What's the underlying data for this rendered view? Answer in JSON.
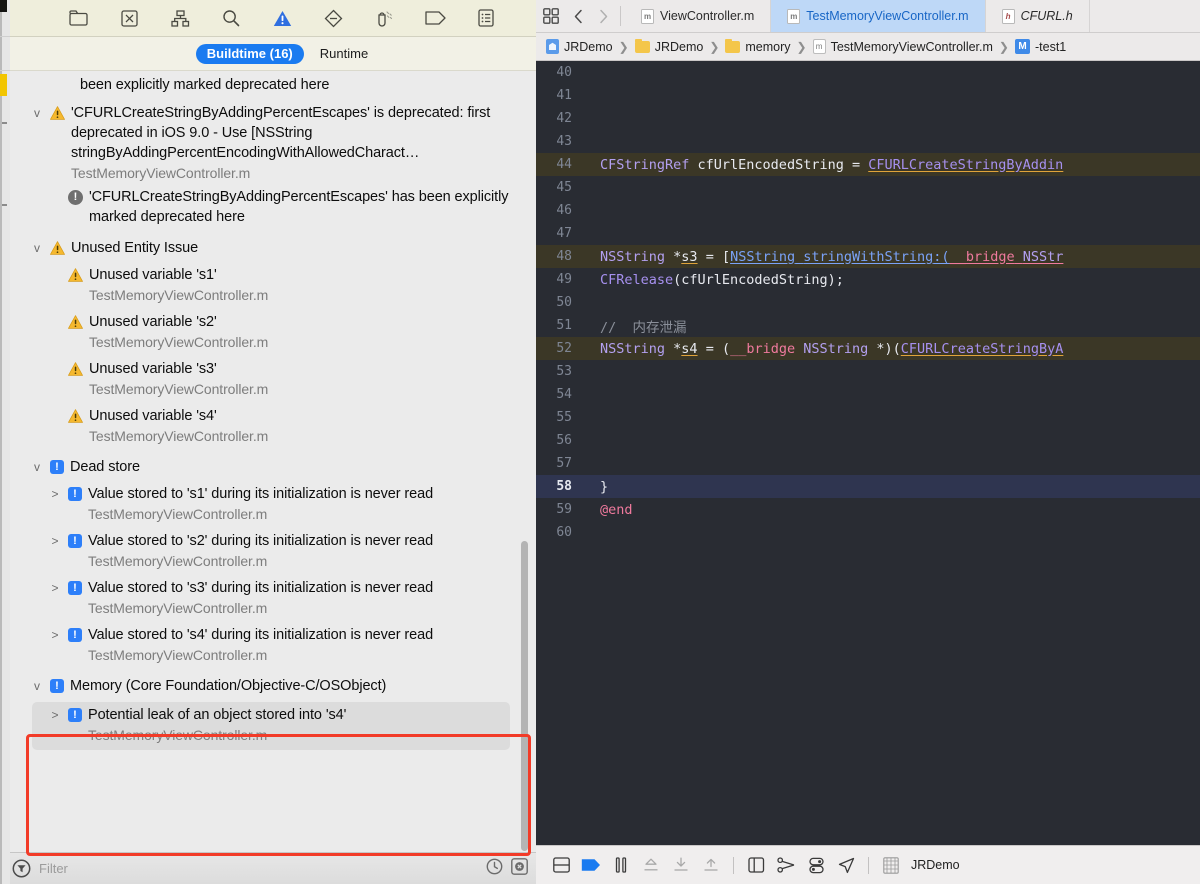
{
  "navigator": {
    "toolbar_icons": [
      "folder-icon",
      "source-control-icon",
      "symbol-hierarchy-icon",
      "search-icon",
      "issue-warning-icon",
      "test-diamond-icon",
      "debug-icon",
      "breakpoint-tag-icon",
      "report-icon"
    ],
    "scope": {
      "buildtime_label": "Buildtime (16)",
      "runtime_label": "Runtime"
    },
    "partial_top_text": "been explicitly marked deprecated here",
    "groups": [
      {
        "id": "deprecation",
        "disclosure": "v",
        "badge": "warning",
        "title": "'CFURLCreateStringByAddingPercentEscapes' is deprecated: first deprecated in iOS 9.0 - Use [NSString stringByAddingPercentEncodingWithAllowedCharact…",
        "file": "TestMemoryViewController.m",
        "children": [
          {
            "badge": "note",
            "title": "'CFURLCreateStringByAddingPercentEscapes' has been explicitly marked deprecated here",
            "file": ""
          }
        ]
      },
      {
        "id": "unused-entity-issue",
        "disclosure": "v",
        "badge": "warning",
        "title": "Unused Entity Issue",
        "file": "",
        "children": [
          {
            "badge": "warning",
            "title": "Unused variable 's1'",
            "file": "TestMemoryViewController.m"
          },
          {
            "badge": "warning",
            "title": "Unused variable 's2'",
            "file": "TestMemoryViewController.m"
          },
          {
            "badge": "warning",
            "title": "Unused variable 's3'",
            "file": "TestMemoryViewController.m"
          },
          {
            "badge": "warning",
            "title": "Unused variable 's4'",
            "file": "TestMemoryViewController.m"
          }
        ]
      },
      {
        "id": "dead-store",
        "disclosure": "v",
        "badge": "issue",
        "title": "Dead store",
        "file": "",
        "children": [
          {
            "badge": "issue",
            "disclosure": ">",
            "title": "Value stored to 's1' during its initialization is never read",
            "file": "TestMemoryViewController.m"
          },
          {
            "badge": "issue",
            "disclosure": ">",
            "title": "Value stored to 's2' during its initialization is never read",
            "file": "TestMemoryViewController.m"
          },
          {
            "badge": "issue",
            "disclosure": ">",
            "title": "Value stored to 's3' during its initialization is never read",
            "file": "TestMemoryViewController.m"
          },
          {
            "badge": "issue",
            "disclosure": ">",
            "title": "Value stored to 's4' during its initialization is never read",
            "file": "TestMemoryViewController.m"
          }
        ]
      },
      {
        "id": "memory",
        "disclosure": "v",
        "badge": "issue",
        "highlighted": true,
        "title": "Memory (Core Foundation/Objective-C/OSObject)",
        "file": "",
        "children": [
          {
            "badge": "issue",
            "disclosure": ">",
            "selected": true,
            "title": "Potential leak of an object stored into 's4'",
            "file": "TestMemoryViewController.m"
          }
        ]
      }
    ],
    "filter": {
      "placeholder": "Filter",
      "icons": [
        "filter-funnel-icon",
        "recent-clock-icon",
        "clear-x-icon"
      ]
    }
  },
  "editor": {
    "tabs": [
      {
        "kind": "m",
        "label": "ViewController.m",
        "active": false,
        "italic": false
      },
      {
        "kind": "m",
        "label": "TestMemoryViewController.m",
        "active": true,
        "italic": false
      },
      {
        "kind": "h",
        "label": "CFURL.h",
        "active": false,
        "italic": true
      }
    ],
    "nav_back_label": "‹",
    "nav_fwd_label": "›",
    "breadcrumb": [
      {
        "icon": "project-icon",
        "label": "JRDemo"
      },
      {
        "icon": "folder-icon",
        "label": "JRDemo"
      },
      {
        "icon": "folder-icon",
        "label": "memory"
      },
      {
        "icon": "m-file-icon",
        "label": "TestMemoryViewController.m"
      },
      {
        "icon": "method-icon",
        "label": "-test1"
      }
    ],
    "code_lines": [
      {
        "n": "40",
        "state": "",
        "tokens": []
      },
      {
        "n": "41",
        "state": "",
        "tokens": []
      },
      {
        "n": "42",
        "state": "",
        "tokens": []
      },
      {
        "n": "43",
        "state": "",
        "tokens": []
      },
      {
        "n": "44",
        "state": "warn",
        "tokens": [
          {
            "t": "CFStringRef",
            "c": "k-type"
          },
          {
            "t": " cfUrlEncodedString ",
            "c": "k-plain"
          },
          {
            "t": "= ",
            "c": "k-plain"
          },
          {
            "t": "CFURLCreateStringByAddin",
            "c": "k-fn u-orange"
          }
        ]
      },
      {
        "n": "45",
        "state": "",
        "tokens": []
      },
      {
        "n": "46",
        "state": "",
        "tokens": []
      },
      {
        "n": "47",
        "state": "",
        "tokens": []
      },
      {
        "n": "48",
        "state": "warn",
        "tokens": [
          {
            "t": "NSString",
            "c": "k-type"
          },
          {
            "t": " *",
            "c": "k-plain"
          },
          {
            "t": "s3",
            "c": "k-plain u-orange"
          },
          {
            "t": " = [",
            "c": "k-plain"
          },
          {
            "t": "NSString",
            "c": "k-msg u-blue"
          },
          {
            "t": " ",
            "c": "k-plain u-blue"
          },
          {
            "t": "stringWithString",
            "c": "k-msg u-blue"
          },
          {
            "t": ":(",
            "c": "k-msg u-blue"
          },
          {
            "t": "__bridge",
            "c": "k-kw u-pink"
          },
          {
            "t": " ",
            "c": "k-plain u-pink"
          },
          {
            "t": "NSStr",
            "c": "k-type u-pink"
          }
        ]
      },
      {
        "n": "49",
        "state": "",
        "tokens": [
          {
            "t": "CFRelease",
            "c": "k-fn"
          },
          {
            "t": "(cfUrlEncodedString);",
            "c": "k-plain"
          }
        ]
      },
      {
        "n": "50",
        "state": "",
        "tokens": []
      },
      {
        "n": "51",
        "state": "",
        "tokens": [
          {
            "t": "//  内存泄漏",
            "c": "k-cmt"
          }
        ]
      },
      {
        "n": "52",
        "state": "warn",
        "tokens": [
          {
            "t": "NSString",
            "c": "k-type"
          },
          {
            "t": " *",
            "c": "k-plain"
          },
          {
            "t": "s4",
            "c": "k-plain u-orange"
          },
          {
            "t": " = (",
            "c": "k-plain"
          },
          {
            "t": "__bridge",
            "c": "k-kw"
          },
          {
            "t": " ",
            "c": "k-plain"
          },
          {
            "t": "NSString",
            "c": "k-type"
          },
          {
            "t": " *)(",
            "c": "k-plain"
          },
          {
            "t": "CFURLCreateStringByA",
            "c": "k-fn u-orange"
          }
        ]
      },
      {
        "n": "53",
        "state": "",
        "tokens": []
      },
      {
        "n": "54",
        "state": "",
        "tokens": []
      },
      {
        "n": "55",
        "state": "",
        "tokens": []
      },
      {
        "n": "56",
        "state": "",
        "tokens": []
      },
      {
        "n": "57",
        "state": "",
        "tokens": []
      },
      {
        "n": "58",
        "state": "cursel",
        "tokens": [
          {
            "t": "}",
            "c": "k-plain"
          }
        ]
      },
      {
        "n": "59",
        "state": "",
        "tokens": [
          {
            "t": "@end",
            "c": "k-kw"
          }
        ]
      },
      {
        "n": "60",
        "state": "",
        "tokens": []
      }
    ],
    "bottom_bar": {
      "icons": [
        "split-editor-icon",
        "breakpoint-flag-icon",
        "pause-icon",
        "step-over-icon",
        "step-into-icon",
        "step-out-icon",
        "view-debug-icon",
        "mem-graph-icon",
        "env-overrides-icon",
        "location-icon",
        "grid-icon"
      ],
      "scheme_label": "JRDemo"
    }
  },
  "colors": {
    "accent_blue": "#1a7bf0",
    "warning_yellow": "#f5b82e",
    "issue_blue": "#2d7ff9",
    "highlight_red": "#f23b28",
    "editor_bg": "#292c33",
    "tab_active_bg": "#bed8f7"
  }
}
